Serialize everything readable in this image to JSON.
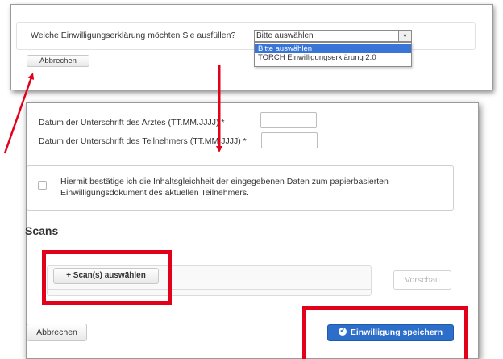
{
  "top_panel": {
    "question": "Welche Einwilligungserklärung möchten Sie ausfüllen?",
    "select_value": "Bitte auswählen",
    "options": [
      "Bitte auswählen",
      "TORCH Einwilligungserklärung 2.0"
    ],
    "cancel_label": "Abbrechen"
  },
  "main_panel": {
    "doctor_date_label": "Datum der Unterschrift des Arztes (TT.MM.JJJJ) *",
    "participant_date_label": "Datum der Unterschrift des Teilnehmers (TT.MM.JJJJ) *",
    "confirm_text": "Hiermit bestätige ich die Inhaltsgleichheit der eingegebenen Daten zum papierbasierten Einwilligungsdokument des aktuellen Teilnehmers.",
    "scans_heading": "Scans",
    "scan_button_label": "Scan(s) auswählen",
    "scan_button_prefix": "+",
    "preview_label": "Vorschau",
    "cancel_label": "Abbrechen",
    "save_label": "Einwilligung speichern",
    "save_icon": "check-circle-icon"
  },
  "annotation_color": "#e3001b"
}
